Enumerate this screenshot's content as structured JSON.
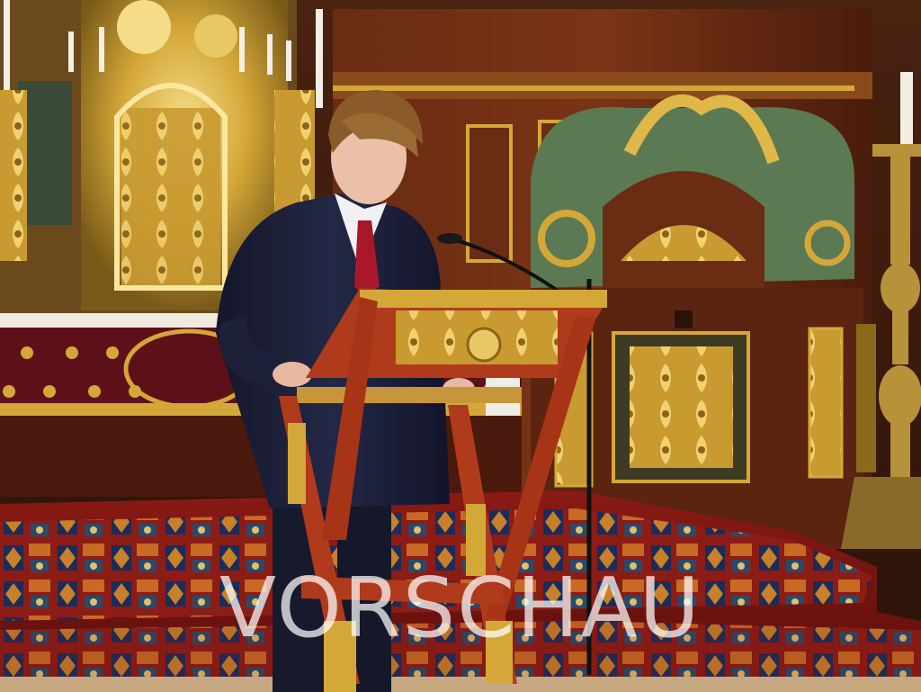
{
  "photo": {
    "watermark_text": "VORSCHAU",
    "colors": {
      "gold": "#d4a838",
      "gold_dark": "#8a6a1a",
      "wood": "#5a2410",
      "green_marble": "#5b7a54",
      "carpet_red": "#9c1a14",
      "carpet_blue": "#1c2c5a",
      "suit": "#1a1e33",
      "tie": "#a8182a",
      "lectern_red": "#b03a1c"
    }
  }
}
